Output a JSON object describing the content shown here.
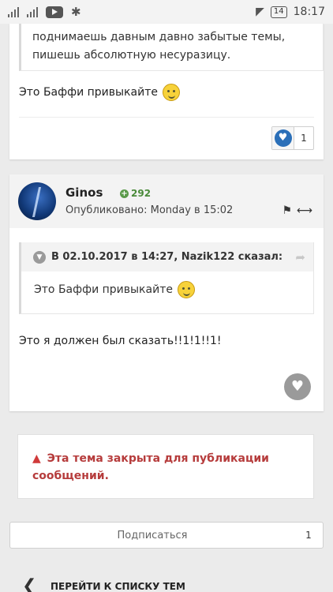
{
  "status_bar": {
    "battery": "14",
    "time": "18:17"
  },
  "post1": {
    "quote_tail_lines": [
      "поднимаешь давным давно забытые темы,",
      "пишешь абсолютную несуразицу."
    ],
    "body": "Это Баффи привыкайте",
    "reaction_count": "1"
  },
  "post2": {
    "author": "Ginos",
    "reputation": "292",
    "published": "Опубликовано: Monday в 15:02",
    "quote_cite": "В 02.10.2017 в 14:27, Nazik122 сказал:",
    "quote_text": "Это Баффи привыкайте",
    "body": "Это я должен был сказать!!1!1!!1!"
  },
  "locked_notice": "Эта тема закрыта для публикации сообщений.",
  "subscribe": {
    "label": "Подписаться",
    "count": "1"
  },
  "go_to_list": "ПЕРЕЙТИ К СПИСКУ ТЕМ",
  "colors": {
    "accent_blue": "#2b6fb8",
    "locked_red": "#b63c3c",
    "reputation_green": "#4a8a3a"
  }
}
